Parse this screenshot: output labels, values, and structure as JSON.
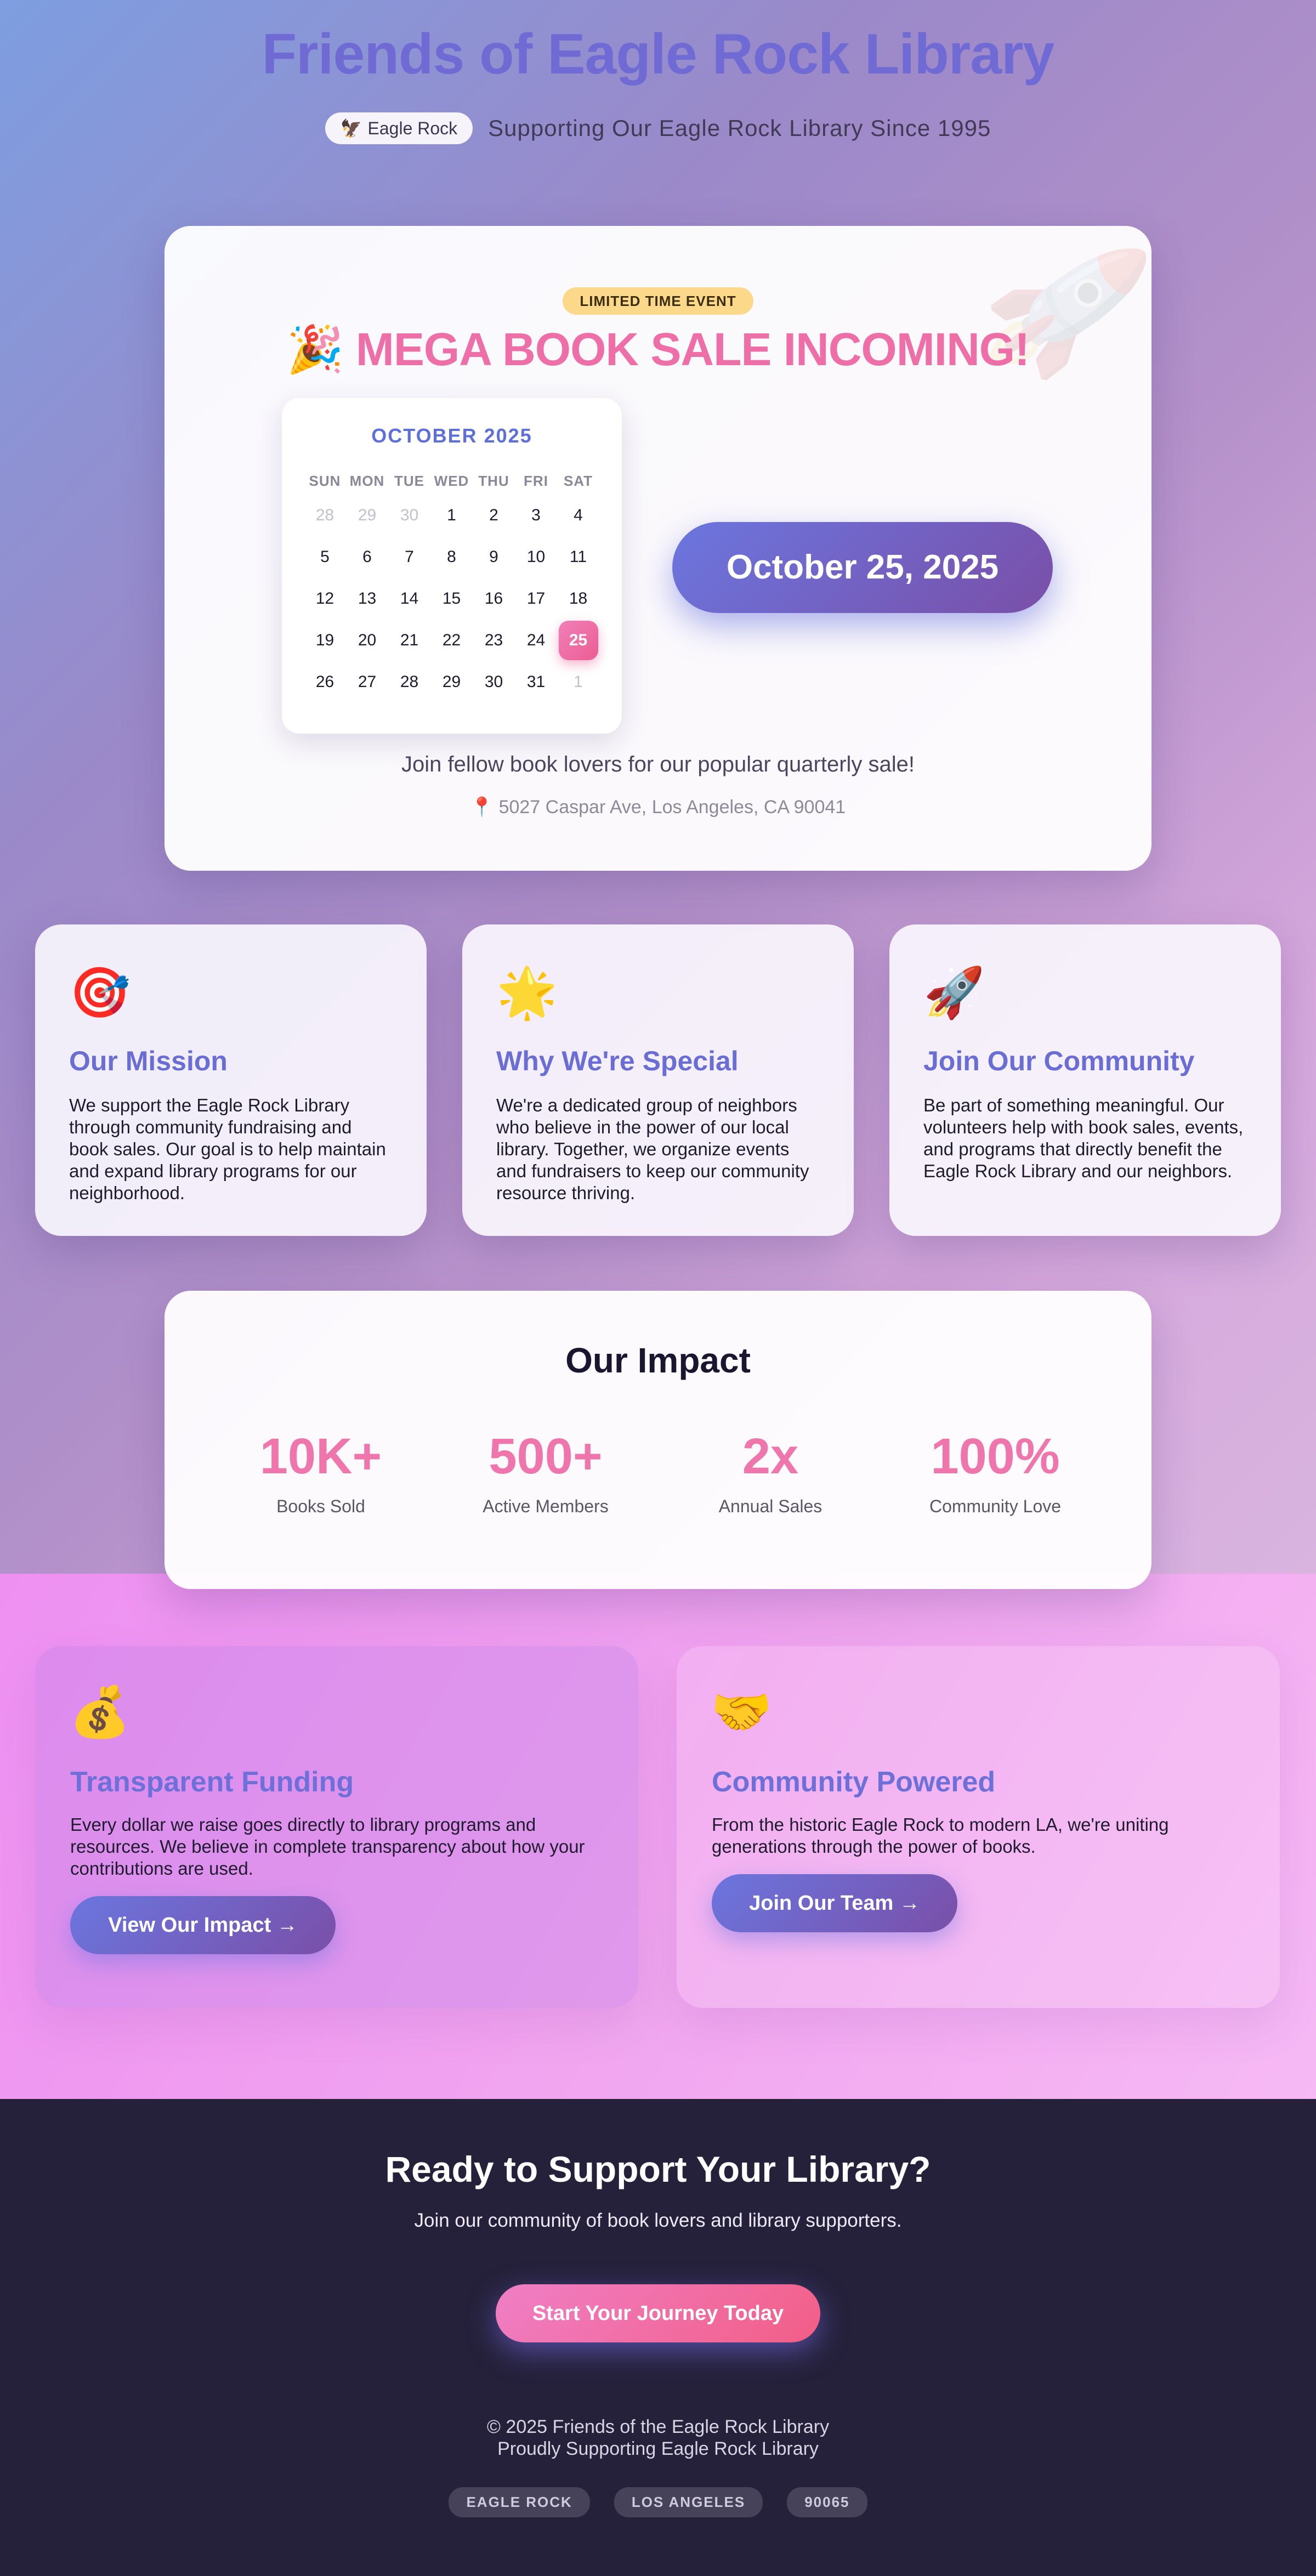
{
  "header": {
    "title": "Friends of Eagle Rock Library",
    "chip_icon": "🦅",
    "chip_label": "Eagle Rock",
    "tagline": "Supporting Our Eagle Rock Library Since 1995"
  },
  "event": {
    "badge": "LIMITED TIME EVENT",
    "title": "🎉 MEGA BOOK SALE INCOMING!",
    "rocket_icon": "🚀",
    "date": "October 25, 2025",
    "description": "Join fellow book lovers for our popular quarterly sale!",
    "address": "📍 5027 Caspar Ave, Los Angeles, CA 90041",
    "calendar": {
      "month": "OCTOBER 2025",
      "weekdays": [
        "SUN",
        "MON",
        "TUE",
        "WED",
        "THU",
        "FRI",
        "SAT"
      ],
      "weeks": [
        [
          "28",
          "29",
          "30",
          "1",
          "2",
          "3",
          "4"
        ],
        [
          "5",
          "6",
          "7",
          "8",
          "9",
          "10",
          "11"
        ],
        [
          "12",
          "13",
          "14",
          "15",
          "16",
          "17",
          "18"
        ],
        [
          "19",
          "20",
          "21",
          "22",
          "23",
          "24",
          "25"
        ],
        [
          "26",
          "27",
          "28",
          "29",
          "30",
          "31",
          "1"
        ]
      ],
      "muted_cells": [
        "0-0",
        "0-1",
        "0-2",
        "4-6"
      ],
      "highlighted_cell": "3-6"
    }
  },
  "features": [
    {
      "icon": "🎯",
      "title": "Our Mission",
      "text": "We support the Eagle Rock Library through community fundraising and book sales. Our goal is to help maintain and expand library programs for our neighborhood."
    },
    {
      "icon": "🌟",
      "title": "Why We're Special",
      "text": "We're a dedicated group of neighbors who believe in the power of our local library. Together, we organize events and fundraisers to keep our community resource thriving."
    },
    {
      "icon": "🚀",
      "title": "Join Our Community",
      "text": "Be part of something meaningful. Our volunteers help with book sales, events, and programs that directly benefit the Eagle Rock Library and our neighbors."
    }
  ],
  "impact": {
    "title": "Our Impact",
    "stats": [
      {
        "value": "10K+",
        "label": "Books Sold"
      },
      {
        "value": "500+",
        "label": "Active Members"
      },
      {
        "value": "2x",
        "label": "Annual Sales"
      },
      {
        "value": "100%",
        "label": "Community Love"
      }
    ]
  },
  "funding": [
    {
      "icon": "💰",
      "title": "Transparent Funding",
      "text": "Every dollar we raise goes directly to library programs and resources. We believe in complete transparency about how your contributions are used.",
      "button": "View Our Impact →"
    },
    {
      "icon": "🤝",
      "title": "Community Powered",
      "text": "From the historic Eagle Rock to modern LA, we're uniting generations through the power of books.",
      "button": "Join Our Team →"
    }
  ],
  "footer": {
    "cta_title": "Ready to Support Your Library?",
    "cta_subtitle": "Join our community of book lovers and library supporters.",
    "cta_button": "Start Your Journey Today",
    "copyright_line1": "© 2025 Friends of the Eagle Rock Library",
    "copyright_line2": "Proudly Supporting Eagle Rock Library",
    "tags": [
      "EAGLE ROCK",
      "LOS ANGELES",
      "90065"
    ]
  },
  "colors": {
    "accent_blue": "#6b76df",
    "accent_pink": "#ee6fa7",
    "badge_yellow": "#fcd98a",
    "footer_dark": "#25213a"
  }
}
